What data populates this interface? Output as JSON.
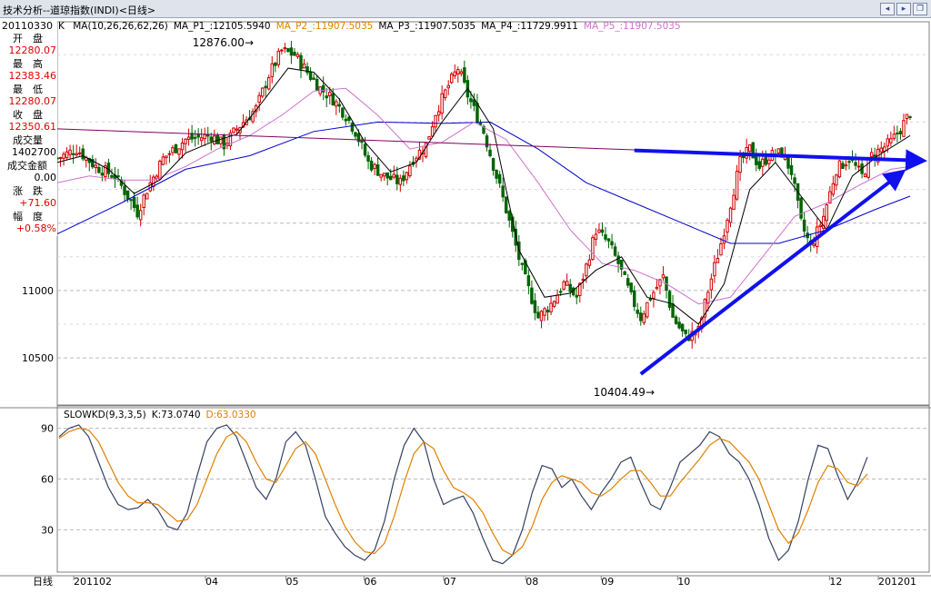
{
  "window": {
    "title": "技术分析--道琼指数(INDI)<日线>",
    "buttons": [
      "back-icon",
      "forward-icon",
      "restore-icon"
    ]
  },
  "info_panel": {
    "date": "20110330",
    "rows": [
      {
        "label": "开　盘",
        "value": "12280.07",
        "color": "#e00000"
      },
      {
        "label": "最　高",
        "value": "12383.46",
        "color": "#e00000"
      },
      {
        "label": "最　低",
        "value": "12280.07",
        "color": "#e00000"
      },
      {
        "label": "收　盘",
        "value": "12350.61",
        "color": "#e00000"
      },
      {
        "label": "成交量",
        "value": "1402700",
        "color": "#000000"
      },
      {
        "label": "成交金额",
        "value": "0.00",
        "color": "#000000"
      },
      {
        "label": "涨　跌",
        "value": "+71.60",
        "color": "#e00000"
      },
      {
        "label": "幅　度",
        "value": "+0.58%",
        "color": "#e00000"
      }
    ]
  },
  "main_legend": {
    "prefix": "K",
    "items": [
      {
        "text": "MA(10,26,26,62,26)",
        "color": "#000000"
      },
      {
        "text": "MA_P1_:12105.5940",
        "color": "#000000"
      },
      {
        "text": "MA_P2_:11907.5035",
        "color": "#e08000"
      },
      {
        "text": "MA_P3_:11907.5035",
        "color": "#000000"
      },
      {
        "text": "MA_P4_:11729.9911",
        "color": "#000000"
      },
      {
        "text": "MA_P5_:11907.5035",
        "color": "#d070d0"
      }
    ]
  },
  "kd_legend": {
    "items": [
      {
        "text": "SLOWKD(9,3,3,5)",
        "color": "#000000"
      },
      {
        "text": "K:73.0740",
        "color": "#000000"
      },
      {
        "text": "D:63.0330",
        "color": "#e08000"
      }
    ]
  },
  "annotations": {
    "high_label": "12876.00",
    "low_label": "10404.49"
  },
  "x_axis": {
    "label": "日线",
    "ticks": [
      {
        "label": "201102",
        "pos": 0.02
      },
      {
        "label": "04",
        "pos": 0.185
      },
      {
        "label": "05",
        "pos": 0.283
      },
      {
        "label": "06",
        "pos": 0.378
      },
      {
        "label": "07",
        "pos": 0.475
      },
      {
        "label": "08",
        "pos": 0.575
      },
      {
        "label": "09",
        "pos": 0.667
      },
      {
        "label": "10",
        "pos": 0.76
      },
      {
        "label": "12",
        "pos": 0.945
      },
      {
        "label": "201201",
        "pos": 1.0
      }
    ]
  },
  "chart_data": [
    {
      "type": "candlestick",
      "title": "道琼指数(INDI) 日线",
      "ylim": [
        10150,
        12900
      ],
      "yticks": [
        10500,
        11000,
        11500
      ],
      "grid": true,
      "colors": {
        "up": "#d00000",
        "down": "#006400",
        "ma1": "#000000",
        "ma2": "#d070d0",
        "ma3": "#0000cc",
        "ma4": "#800060"
      },
      "close_path": [
        [
          0,
          11980
        ],
        [
          6,
          12050
        ],
        [
          12,
          11920
        ],
        [
          18,
          11850
        ],
        [
          22,
          11700
        ],
        [
          25,
          11580
        ],
        [
          28,
          11750
        ],
        [
          33,
          11980
        ],
        [
          40,
          12120
        ],
        [
          48,
          12150
        ],
        [
          52,
          12080
        ],
        [
          56,
          12200
        ],
        [
          62,
          12350
        ],
        [
          66,
          12600
        ],
        [
          70,
          12780
        ],
        [
          74,
          12750
        ],
        [
          78,
          12620
        ],
        [
          82,
          12500
        ],
        [
          86,
          12420
        ],
        [
          90,
          12300
        ],
        [
          93,
          12180
        ],
        [
          97,
          11950
        ],
        [
          102,
          11850
        ],
        [
          107,
          11800
        ],
        [
          111,
          11980
        ],
        [
          115,
          12080
        ],
        [
          118,
          12320
        ],
        [
          122,
          12520
        ],
        [
          125,
          12650
        ],
        [
          128,
          12450
        ],
        [
          133,
          12180
        ],
        [
          140,
          11600
        ],
        [
          145,
          11150
        ],
        [
          150,
          10800
        ],
        [
          154,
          10900
        ],
        [
          158,
          11050
        ],
        [
          162,
          10950
        ],
        [
          165,
          11180
        ],
        [
          168,
          11450
        ],
        [
          172,
          11350
        ],
        [
          175,
          11200
        ],
        [
          179,
          10950
        ],
        [
          182,
          10800
        ],
        [
          185,
          10950
        ],
        [
          189,
          11100
        ],
        [
          192,
          10800
        ],
        [
          196,
          10650
        ],
        [
          200,
          10700
        ],
        [
          203,
          11000
        ],
        [
          207,
          11350
        ],
        [
          210,
          11650
        ],
        [
          213,
          11950
        ],
        [
          216,
          12050
        ],
        [
          219,
          11920
        ],
        [
          222,
          12000
        ],
        [
          226,
          12020
        ],
        [
          229,
          11880
        ],
        [
          232,
          11500
        ],
        [
          235,
          11320
        ],
        [
          239,
          11550
        ],
        [
          243,
          11900
        ],
        [
          247,
          11980
        ],
        [
          251,
          11850
        ],
        [
          254,
          12000
        ],
        [
          257,
          12050
        ],
        [
          260,
          12100
        ],
        [
          263,
          12200
        ],
        [
          266,
          12320
        ]
      ],
      "ma10_path": [
        [
          0,
          11950
        ],
        [
          8,
          12000
        ],
        [
          16,
          11900
        ],
        [
          24,
          11720
        ],
        [
          32,
          11820
        ],
        [
          40,
          12020
        ],
        [
          48,
          12100
        ],
        [
          56,
          12160
        ],
        [
          64,
          12400
        ],
        [
          72,
          12650
        ],
        [
          80,
          12620
        ],
        [
          88,
          12420
        ],
        [
          96,
          12100
        ],
        [
          104,
          11880
        ],
        [
          112,
          11950
        ],
        [
          120,
          12250
        ],
        [
          128,
          12500
        ],
        [
          136,
          12200
        ],
        [
          144,
          11300
        ],
        [
          152,
          10950
        ],
        [
          160,
          10980
        ],
        [
          168,
          11150
        ],
        [
          176,
          11250
        ],
        [
          184,
          10950
        ],
        [
          192,
          10900
        ],
        [
          200,
          10750
        ],
        [
          208,
          11050
        ],
        [
          216,
          11750
        ],
        [
          224,
          11950
        ],
        [
          232,
          11700
        ],
        [
          240,
          11450
        ],
        [
          248,
          11850
        ],
        [
          256,
          12000
        ],
        [
          266,
          12150
        ]
      ],
      "ma26_path": [
        [
          0,
          11800
        ],
        [
          10,
          11850
        ],
        [
          20,
          11820
        ],
        [
          30,
          11820
        ],
        [
          40,
          11920
        ],
        [
          50,
          12050
        ],
        [
          60,
          12150
        ],
        [
          70,
          12300
        ],
        [
          80,
          12480
        ],
        [
          90,
          12500
        ],
        [
          100,
          12300
        ],
        [
          110,
          12050
        ],
        [
          120,
          12100
        ],
        [
          130,
          12250
        ],
        [
          140,
          12120
        ],
        [
          150,
          11800
        ],
        [
          160,
          11450
        ],
        [
          170,
          11200
        ],
        [
          180,
          11150
        ],
        [
          190,
          11050
        ],
        [
          200,
          10900
        ],
        [
          210,
          10950
        ],
        [
          220,
          11250
        ],
        [
          230,
          11550
        ],
        [
          240,
          11650
        ],
        [
          250,
          11780
        ],
        [
          260,
          11900
        ],
        [
          266,
          11920
        ]
      ],
      "ma62_path": [
        [
          0,
          11420
        ],
        [
          20,
          11650
        ],
        [
          40,
          11900
        ],
        [
          60,
          12000
        ],
        [
          80,
          12180
        ],
        [
          100,
          12250
        ],
        [
          120,
          12240
        ],
        [
          135,
          12250
        ],
        [
          150,
          12050
        ],
        [
          165,
          11800
        ],
        [
          180,
          11650
        ],
        [
          195,
          11500
        ],
        [
          210,
          11350
        ],
        [
          225,
          11350
        ],
        [
          240,
          11450
        ],
        [
          255,
          11600
        ],
        [
          266,
          11700
        ]
      ],
      "trend_path": [
        [
          0,
          12200
        ],
        [
          266,
          11970
        ]
      ],
      "blue_arrows": [
        {
          "from": [
            180,
            12040
          ],
          "to": [
            268,
            11965
          ]
        },
        {
          "from": [
            182,
            10380
          ],
          "to": [
            262,
            11850
          ]
        }
      ]
    },
    {
      "type": "line",
      "title": "SLOWKD(9,3,3,5)",
      "ylim": [
        5,
        100
      ],
      "yticks": [
        30,
        60,
        90
      ],
      "grid": true,
      "series": [
        {
          "name": "K",
          "color": "#334060",
          "values": [
            85,
            90,
            92,
            85,
            70,
            55,
            45,
            42,
            43,
            48,
            42,
            32,
            30,
            40,
            62,
            82,
            90,
            92,
            85,
            70,
            55,
            48,
            60,
            82,
            88,
            80,
            60,
            38,
            28,
            20,
            15,
            12,
            18,
            35,
            60,
            80,
            90,
            82,
            60,
            45,
            48,
            50,
            40,
            25,
            12,
            10,
            15,
            30,
            52,
            68,
            66,
            55,
            60,
            50,
            42,
            52,
            60,
            70,
            73,
            58,
            45,
            42,
            55,
            70,
            75,
            80,
            88,
            85,
            75,
            70,
            60,
            45,
            25,
            12,
            18,
            35,
            60,
            80,
            78,
            62,
            48,
            58,
            73
          ]
        },
        {
          "name": "D",
          "color": "#e08000",
          "values": [
            84,
            88,
            90,
            89,
            82,
            70,
            58,
            50,
            46,
            46,
            45,
            40,
            35,
            36,
            45,
            60,
            75,
            85,
            88,
            82,
            70,
            60,
            58,
            68,
            78,
            82,
            75,
            60,
            45,
            32,
            23,
            17,
            16,
            22,
            38,
            58,
            75,
            82,
            78,
            65,
            55,
            52,
            48,
            40,
            28,
            18,
            15,
            20,
            32,
            48,
            58,
            62,
            60,
            58,
            52,
            50,
            54,
            60,
            65,
            65,
            58,
            50,
            50,
            58,
            65,
            72,
            80,
            84,
            82,
            76,
            70,
            60,
            45,
            30,
            22,
            28,
            42,
            58,
            68,
            66,
            58,
            56,
            63
          ]
        }
      ]
    }
  ]
}
